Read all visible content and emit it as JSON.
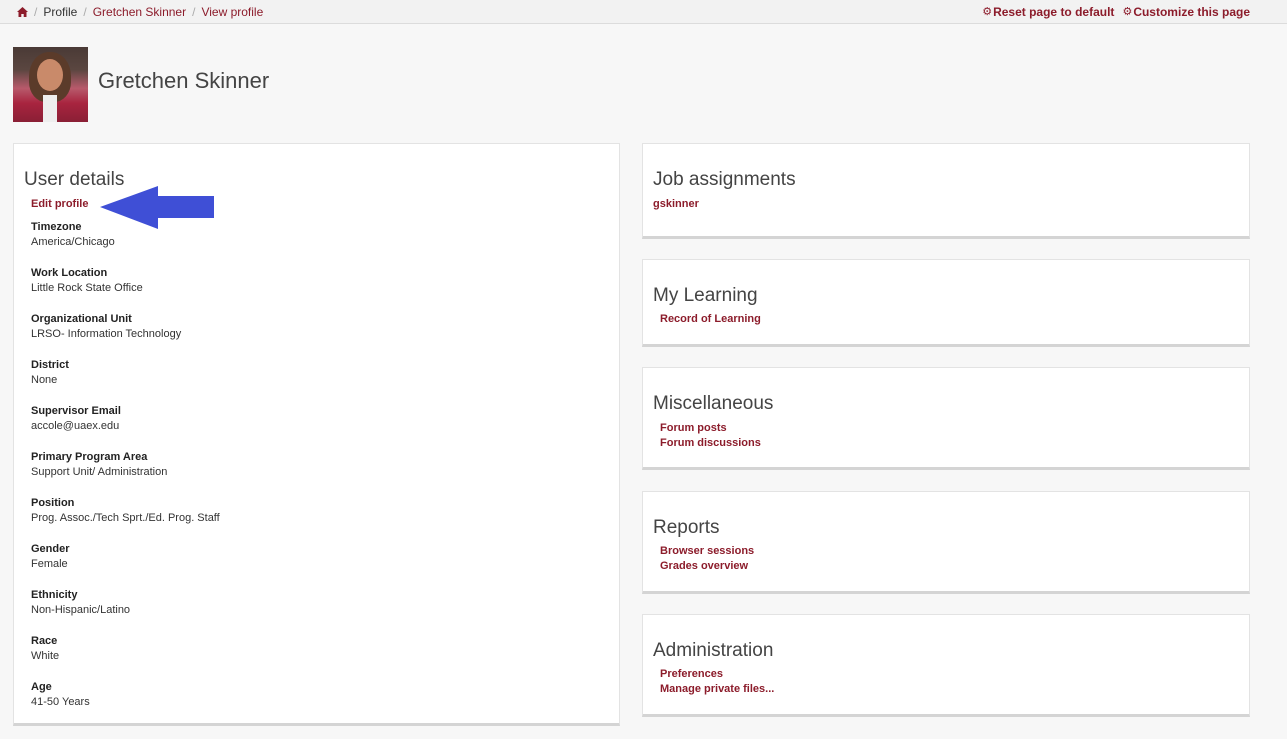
{
  "breadcrumb": {
    "items": [
      {
        "label": "Profile",
        "link": false
      },
      {
        "label": "Gretchen Skinner",
        "link": true
      },
      {
        "label": "View profile",
        "link": true
      }
    ],
    "separator": "/"
  },
  "toolbar": {
    "reset_label": "Reset page to default",
    "customize_label": "Customize this page"
  },
  "header": {
    "name": "Gretchen Skinner"
  },
  "user_details": {
    "title": "User details",
    "edit_label": "Edit profile",
    "fields": [
      {
        "label": "Timezone",
        "value": "America/Chicago"
      },
      {
        "label": "Work Location",
        "value": "Little Rock State Office"
      },
      {
        "label": "Organizational Unit",
        "value": "LRSO- Information Technology"
      },
      {
        "label": "District",
        "value": "None"
      },
      {
        "label": "Supervisor Email",
        "value": "accole@uaex.edu"
      },
      {
        "label": "Primary Program Area",
        "value": "Support Unit/ Administration"
      },
      {
        "label": "Position",
        "value": "Prog. Assoc./Tech Sprt./Ed. Prog. Staff"
      },
      {
        "label": "Gender",
        "value": "Female"
      },
      {
        "label": "Ethnicity",
        "value": "Non-Hispanic/Latino"
      },
      {
        "label": "Race",
        "value": "White"
      },
      {
        "label": "Age",
        "value": "41-50 Years"
      }
    ]
  },
  "job_assignments": {
    "title": "Job assignments",
    "items": [
      "gskinner"
    ]
  },
  "my_learning": {
    "title": "My Learning",
    "items": [
      "Record of Learning"
    ]
  },
  "miscellaneous": {
    "title": "Miscellaneous",
    "items": [
      "Forum posts",
      "Forum discussions"
    ]
  },
  "reports": {
    "title": "Reports",
    "items": [
      "Browser sessions",
      "Grades overview"
    ]
  },
  "administration": {
    "title": "Administration",
    "items": [
      "Preferences",
      "Manage private files..."
    ]
  },
  "colors": {
    "link": "#8c1c2b",
    "arrow": "#3f4fd6"
  },
  "icons": [
    "home-icon",
    "gear-icon",
    "arrow-annotation"
  ]
}
